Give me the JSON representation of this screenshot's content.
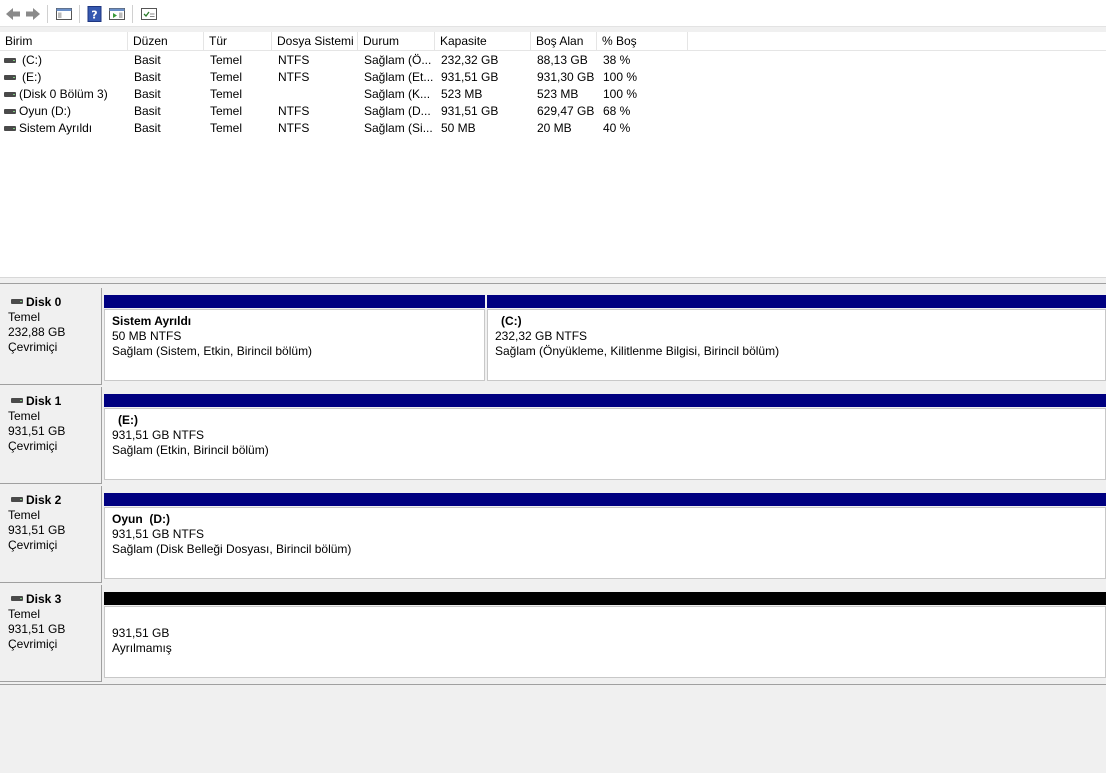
{
  "toolbar": {
    "buttons": [
      "back-icon",
      "forward-icon",
      "console-tree-icon",
      "help-icon",
      "action-pane-icon",
      "properties-icon"
    ]
  },
  "columns": [
    "Birim",
    "Düzen",
    "Tür",
    "Dosya Sistemi",
    "Durum",
    "Kapasite",
    "Boş Alan",
    "% Boş"
  ],
  "volumes": [
    {
      "name": "(C:)",
      "layout": "Basit",
      "type": "Temel",
      "fs": "NTFS",
      "status": "Sağlam (Ö...",
      "capacity": "232,32 GB",
      "free": "88,13 GB",
      "pct": "38 %"
    },
    {
      "name": "(E:)",
      "layout": "Basit",
      "type": "Temel",
      "fs": "NTFS",
      "status": "Sağlam (Et...",
      "capacity": "931,51 GB",
      "free": "931,30 GB",
      "pct": "100 %"
    },
    {
      "name": "(Disk 0 Bölüm 3)",
      "layout": "Basit",
      "type": "Temel",
      "fs": "",
      "status": "Sağlam (K...",
      "capacity": "523 MB",
      "free": "523 MB",
      "pct": "100 %"
    },
    {
      "name": "Oyun (D:)",
      "layout": "Basit",
      "type": "Temel",
      "fs": "NTFS",
      "status": "Sağlam (D...",
      "capacity": "931,51 GB",
      "free": "629,47 GB",
      "pct": "68 %"
    },
    {
      "name": "Sistem Ayrıldı",
      "layout": "Basit",
      "type": "Temel",
      "fs": "NTFS",
      "status": "Sağlam (Si...",
      "capacity": "50 MB",
      "free": "20 MB",
      "pct": "40 %"
    }
  ],
  "disks": [
    {
      "title": "Disk 0",
      "type": "Temel",
      "size": "232,88 GB",
      "state": "Çevrimiçi",
      "partitions": [
        {
          "name": "Sistem Ayrıldı",
          "size": "50 MB NTFS",
          "status": "Sağlam (Sistem, Etkin, Birincil bölüm)"
        },
        {
          "name": "(C:)",
          "size": "232,32 GB NTFS",
          "status": "Sağlam (Önyükleme, Kilitlenme Bilgisi, Birincil bölüm)"
        }
      ]
    },
    {
      "title": "Disk 1",
      "type": "Temel",
      "size": "931,51 GB",
      "state": "Çevrimiçi",
      "partitions": [
        {
          "name": "(E:)",
          "size": "931,51 GB NTFS",
          "status": "Sağlam (Etkin, Birincil bölüm)"
        }
      ]
    },
    {
      "title": "Disk 2",
      "type": "Temel",
      "size": "931,51 GB",
      "state": "Çevrimiçi",
      "partitions": [
        {
          "name": "Oyun  (D:)",
          "size": "931,51 GB NTFS",
          "status": "Sağlam (Disk Belleği Dosyası, Birincil bölüm)"
        }
      ]
    },
    {
      "title": "Disk 3",
      "type": "Temel",
      "size": "931,51 GB",
      "state": "Çevrimiçi",
      "partitions": [
        {
          "name": "",
          "size": "931,51 GB",
          "status": "Ayrılmamış"
        }
      ]
    }
  ],
  "colors": {
    "primary_partition": "#000080",
    "unallocated": "#000000"
  }
}
